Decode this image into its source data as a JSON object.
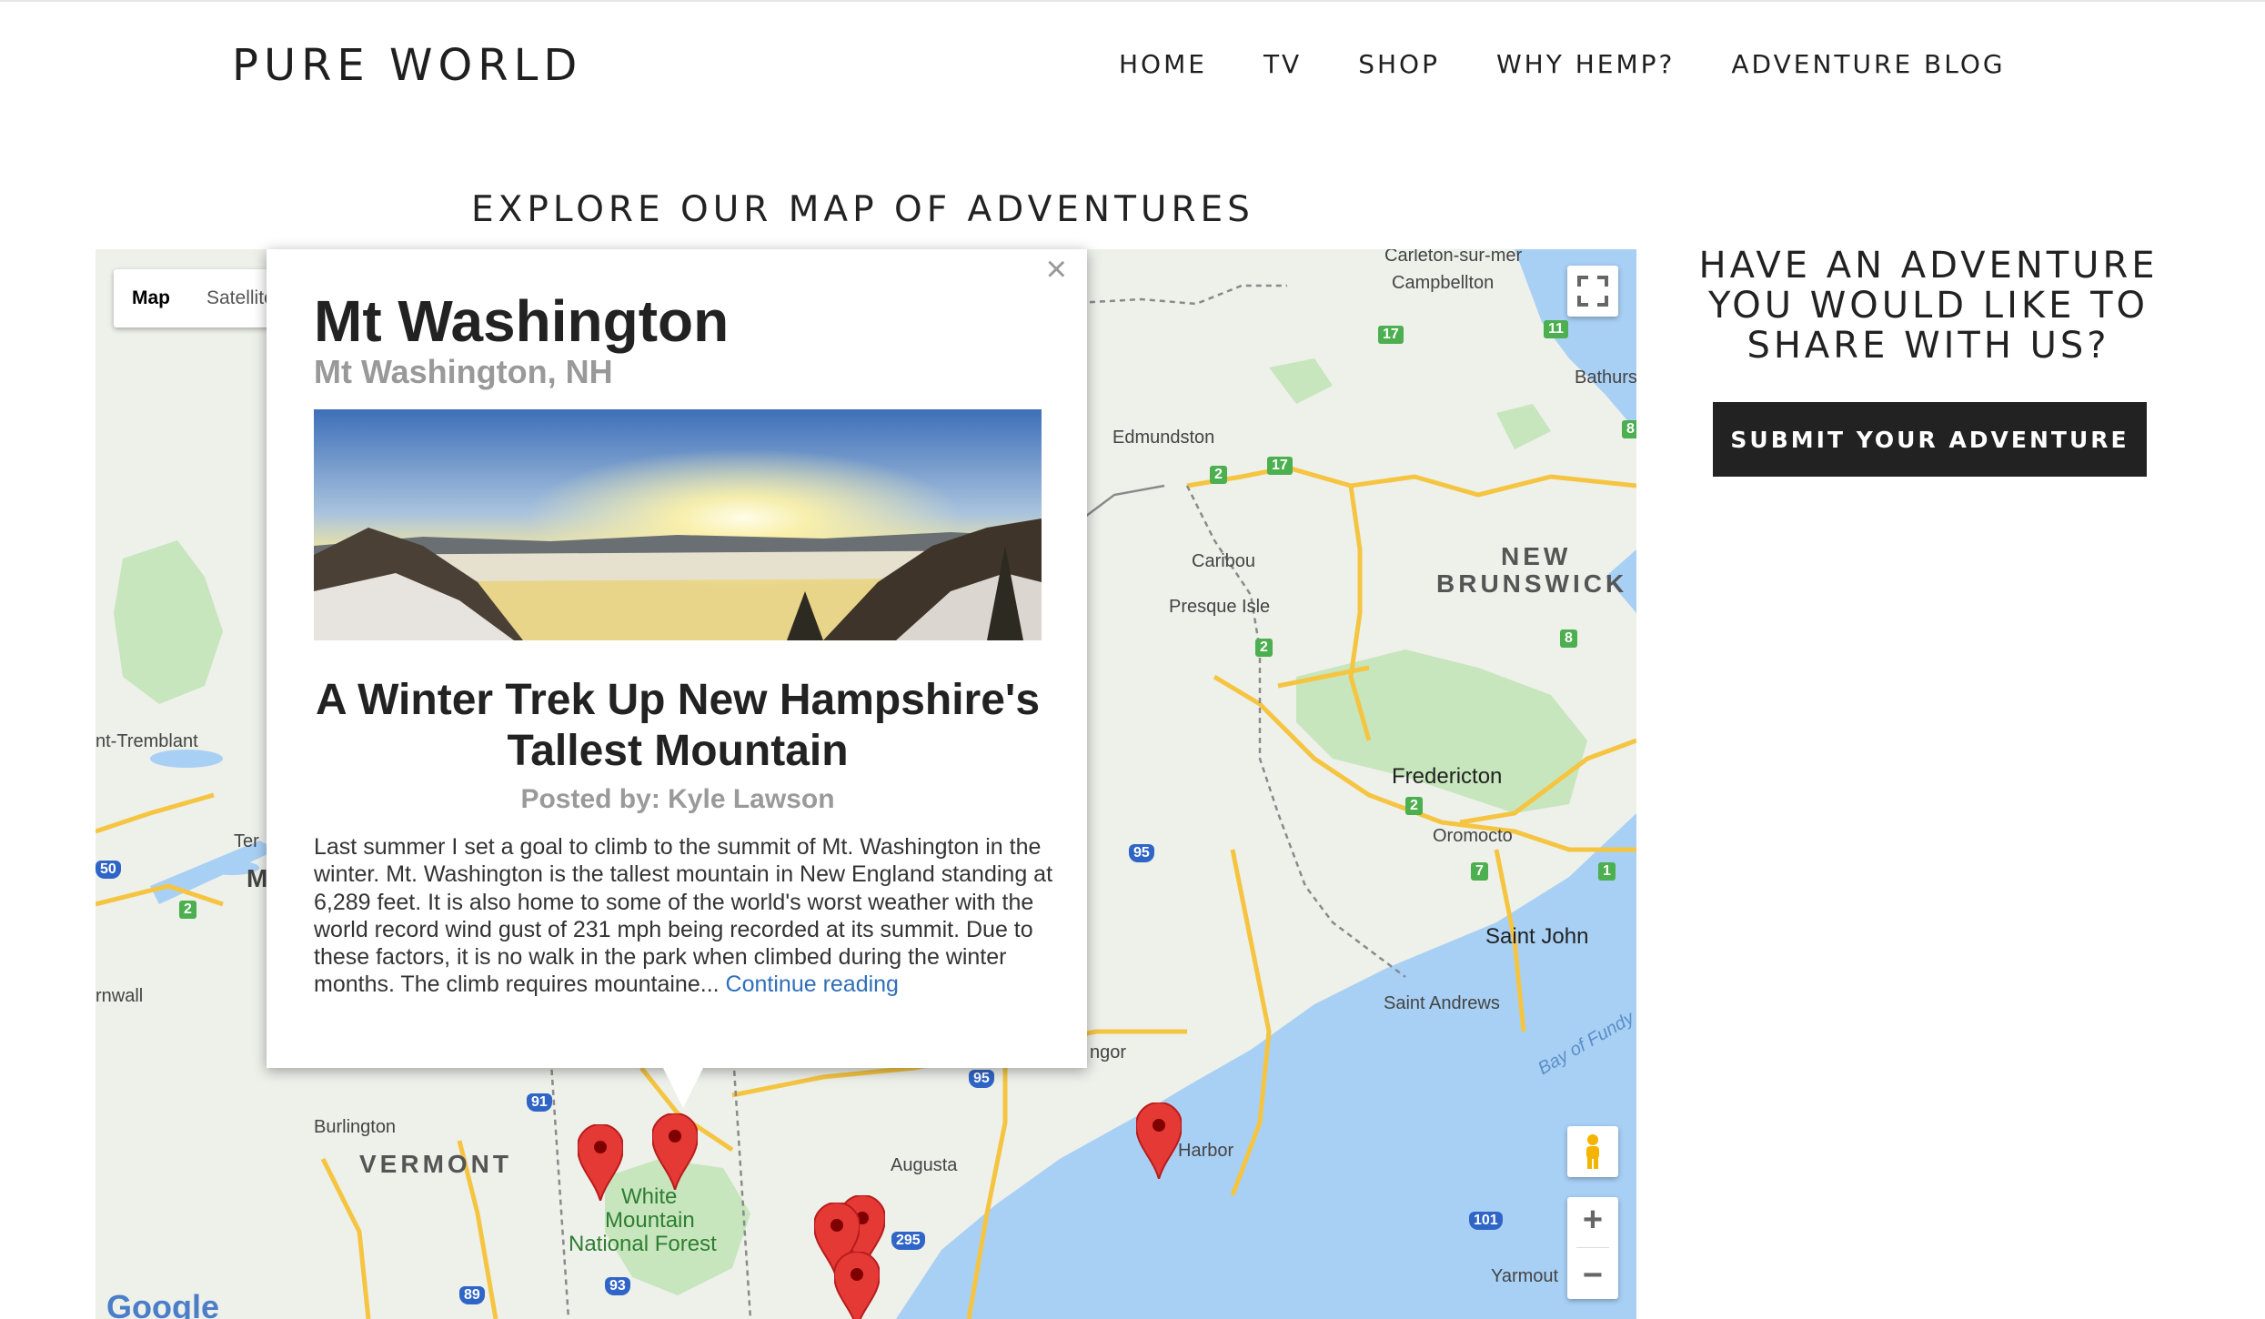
{
  "header": {
    "brand": "PURE WORLD",
    "nav": [
      {
        "label": "HOME"
      },
      {
        "label": "TV"
      },
      {
        "label": "SHOP"
      },
      {
        "label": "WHY HEMP?"
      },
      {
        "label": "ADVENTURE BLOG"
      }
    ]
  },
  "main": {
    "section_title": "EXPLORE OUR MAP OF ADVENTURES"
  },
  "map": {
    "type_buttons": {
      "map": "Map",
      "satellite": "Satellite"
    },
    "zoom_in": "+",
    "zoom_out": "−",
    "labels": {
      "new_brunswick_1": "NEW",
      "new_brunswick_2": "BRUNSWICK",
      "vermont": "VERMONT",
      "white_mountain": "White",
      "white_mountain_2": "Mountain",
      "white_mountain_3": "National Forest",
      "edmundston": "Edmundston",
      "caribou": "Caribou",
      "presque_isle": "Presque Isle",
      "fredericton": "Fredericton",
      "oromocto": "Oromocto",
      "saint_john": "Saint John",
      "saint_andrews": "Saint Andrews",
      "bay_of_fundy": "Bay of Fundy",
      "campbellton": "Campbellton",
      "carleton": "Carleton-sur-mer",
      "bathurst": "Bathurs",
      "tremblant": "nt-Tremblant",
      "cornwall": "rnwall",
      "burlington": "Burlington",
      "augusta": "Augusta",
      "harbor": "Harbor",
      "yarmouth": "Yarmout",
      "bangor": "ngor",
      "ter": "Ter",
      "m": "M",
      "google": "Google"
    },
    "shields": [
      "17",
      "11",
      "17",
      "8",
      "8",
      "7",
      "1",
      "95",
      "95",
      "91",
      "93",
      "89",
      "295",
      "101",
      "50",
      "2",
      "2",
      "2",
      "2"
    ]
  },
  "popup": {
    "close": "×",
    "place": "Mt Washington",
    "location": "Mt Washington, NH",
    "post_title": "A Winter Trek Up New Hampshire's Tallest Mountain",
    "author": "Posted by: Kyle Lawson",
    "excerpt": "Last summer I set a goal to climb to the summit of Mt. Washington in the winter. Mt. Washington is the tallest mountain in New England standing at 6,289 feet. It is also home to some of the world's worst weather with the world record wind gust of 231 mph being recorded at its summit. Due to these factors, it is no walk in the park when climbed during the winter months. The climb requires mountaine...",
    "continue": "Continue reading"
  },
  "sidebar": {
    "title": "HAVE AN ADVENTURE YOU WOULD LIKE TO SHARE WITH US?",
    "submit": "SUBMIT YOUR ADVENTURE"
  },
  "colors": {
    "water": "#a8d0f5",
    "land": "#eef0ea",
    "park": "#c7e6bd",
    "road": "#f5c542",
    "pin": "#e53935",
    "button": "#222222"
  }
}
